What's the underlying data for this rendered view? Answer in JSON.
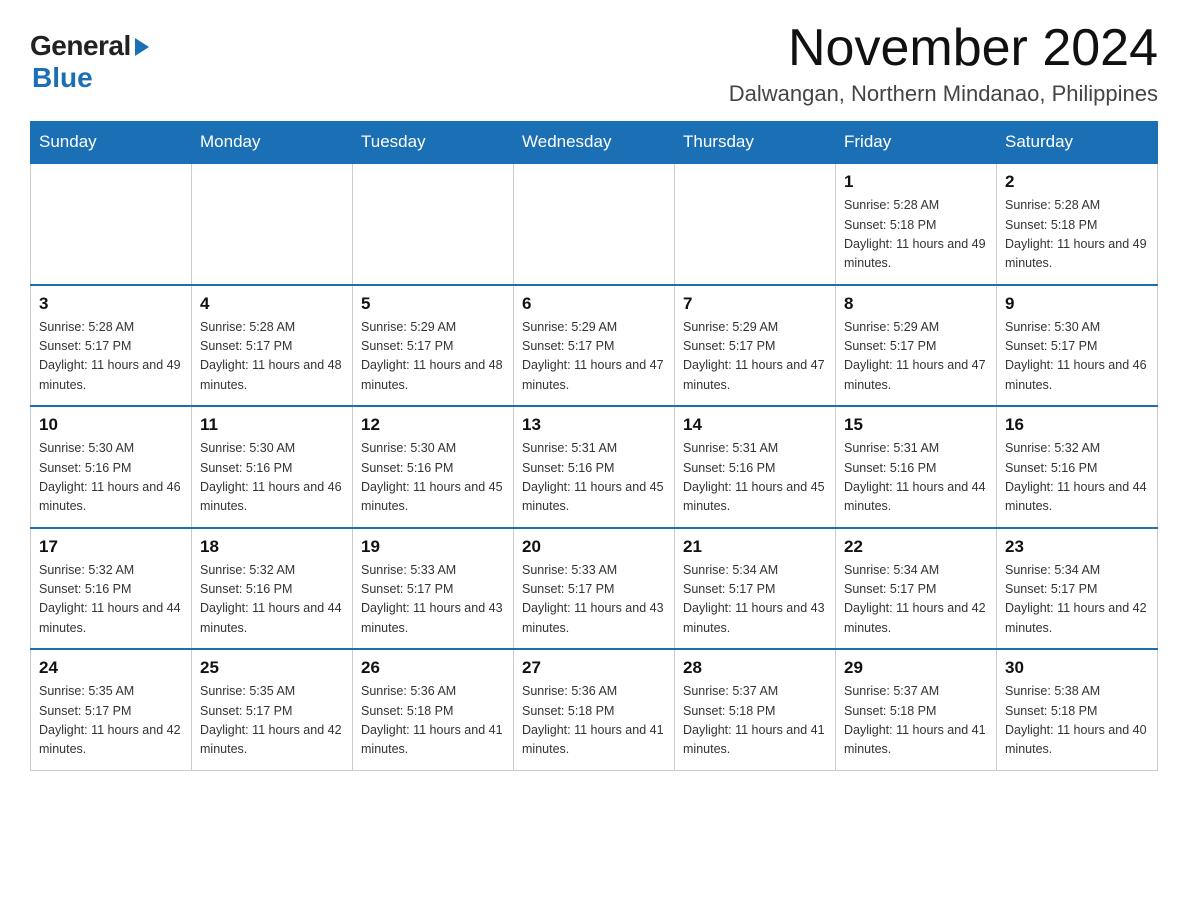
{
  "logo": {
    "general": "General",
    "blue": "Blue"
  },
  "title": "November 2024",
  "subtitle": "Dalwangan, Northern Mindanao, Philippines",
  "weekdays": [
    "Sunday",
    "Monday",
    "Tuesday",
    "Wednesday",
    "Thursday",
    "Friday",
    "Saturday"
  ],
  "weeks": [
    [
      {
        "day": "",
        "info": ""
      },
      {
        "day": "",
        "info": ""
      },
      {
        "day": "",
        "info": ""
      },
      {
        "day": "",
        "info": ""
      },
      {
        "day": "",
        "info": ""
      },
      {
        "day": "1",
        "info": "Sunrise: 5:28 AM\nSunset: 5:18 PM\nDaylight: 11 hours and 49 minutes."
      },
      {
        "day": "2",
        "info": "Sunrise: 5:28 AM\nSunset: 5:18 PM\nDaylight: 11 hours and 49 minutes."
      }
    ],
    [
      {
        "day": "3",
        "info": "Sunrise: 5:28 AM\nSunset: 5:17 PM\nDaylight: 11 hours and 49 minutes."
      },
      {
        "day": "4",
        "info": "Sunrise: 5:28 AM\nSunset: 5:17 PM\nDaylight: 11 hours and 48 minutes."
      },
      {
        "day": "5",
        "info": "Sunrise: 5:29 AM\nSunset: 5:17 PM\nDaylight: 11 hours and 48 minutes."
      },
      {
        "day": "6",
        "info": "Sunrise: 5:29 AM\nSunset: 5:17 PM\nDaylight: 11 hours and 47 minutes."
      },
      {
        "day": "7",
        "info": "Sunrise: 5:29 AM\nSunset: 5:17 PM\nDaylight: 11 hours and 47 minutes."
      },
      {
        "day": "8",
        "info": "Sunrise: 5:29 AM\nSunset: 5:17 PM\nDaylight: 11 hours and 47 minutes."
      },
      {
        "day": "9",
        "info": "Sunrise: 5:30 AM\nSunset: 5:17 PM\nDaylight: 11 hours and 46 minutes."
      }
    ],
    [
      {
        "day": "10",
        "info": "Sunrise: 5:30 AM\nSunset: 5:16 PM\nDaylight: 11 hours and 46 minutes."
      },
      {
        "day": "11",
        "info": "Sunrise: 5:30 AM\nSunset: 5:16 PM\nDaylight: 11 hours and 46 minutes."
      },
      {
        "day": "12",
        "info": "Sunrise: 5:30 AM\nSunset: 5:16 PM\nDaylight: 11 hours and 45 minutes."
      },
      {
        "day": "13",
        "info": "Sunrise: 5:31 AM\nSunset: 5:16 PM\nDaylight: 11 hours and 45 minutes."
      },
      {
        "day": "14",
        "info": "Sunrise: 5:31 AM\nSunset: 5:16 PM\nDaylight: 11 hours and 45 minutes."
      },
      {
        "day": "15",
        "info": "Sunrise: 5:31 AM\nSunset: 5:16 PM\nDaylight: 11 hours and 44 minutes."
      },
      {
        "day": "16",
        "info": "Sunrise: 5:32 AM\nSunset: 5:16 PM\nDaylight: 11 hours and 44 minutes."
      }
    ],
    [
      {
        "day": "17",
        "info": "Sunrise: 5:32 AM\nSunset: 5:16 PM\nDaylight: 11 hours and 44 minutes."
      },
      {
        "day": "18",
        "info": "Sunrise: 5:32 AM\nSunset: 5:16 PM\nDaylight: 11 hours and 44 minutes."
      },
      {
        "day": "19",
        "info": "Sunrise: 5:33 AM\nSunset: 5:17 PM\nDaylight: 11 hours and 43 minutes."
      },
      {
        "day": "20",
        "info": "Sunrise: 5:33 AM\nSunset: 5:17 PM\nDaylight: 11 hours and 43 minutes."
      },
      {
        "day": "21",
        "info": "Sunrise: 5:34 AM\nSunset: 5:17 PM\nDaylight: 11 hours and 43 minutes."
      },
      {
        "day": "22",
        "info": "Sunrise: 5:34 AM\nSunset: 5:17 PM\nDaylight: 11 hours and 42 minutes."
      },
      {
        "day": "23",
        "info": "Sunrise: 5:34 AM\nSunset: 5:17 PM\nDaylight: 11 hours and 42 minutes."
      }
    ],
    [
      {
        "day": "24",
        "info": "Sunrise: 5:35 AM\nSunset: 5:17 PM\nDaylight: 11 hours and 42 minutes."
      },
      {
        "day": "25",
        "info": "Sunrise: 5:35 AM\nSunset: 5:17 PM\nDaylight: 11 hours and 42 minutes."
      },
      {
        "day": "26",
        "info": "Sunrise: 5:36 AM\nSunset: 5:18 PM\nDaylight: 11 hours and 41 minutes."
      },
      {
        "day": "27",
        "info": "Sunrise: 5:36 AM\nSunset: 5:18 PM\nDaylight: 11 hours and 41 minutes."
      },
      {
        "day": "28",
        "info": "Sunrise: 5:37 AM\nSunset: 5:18 PM\nDaylight: 11 hours and 41 minutes."
      },
      {
        "day": "29",
        "info": "Sunrise: 5:37 AM\nSunset: 5:18 PM\nDaylight: 11 hours and 41 minutes."
      },
      {
        "day": "30",
        "info": "Sunrise: 5:38 AM\nSunset: 5:18 PM\nDaylight: 11 hours and 40 minutes."
      }
    ]
  ]
}
